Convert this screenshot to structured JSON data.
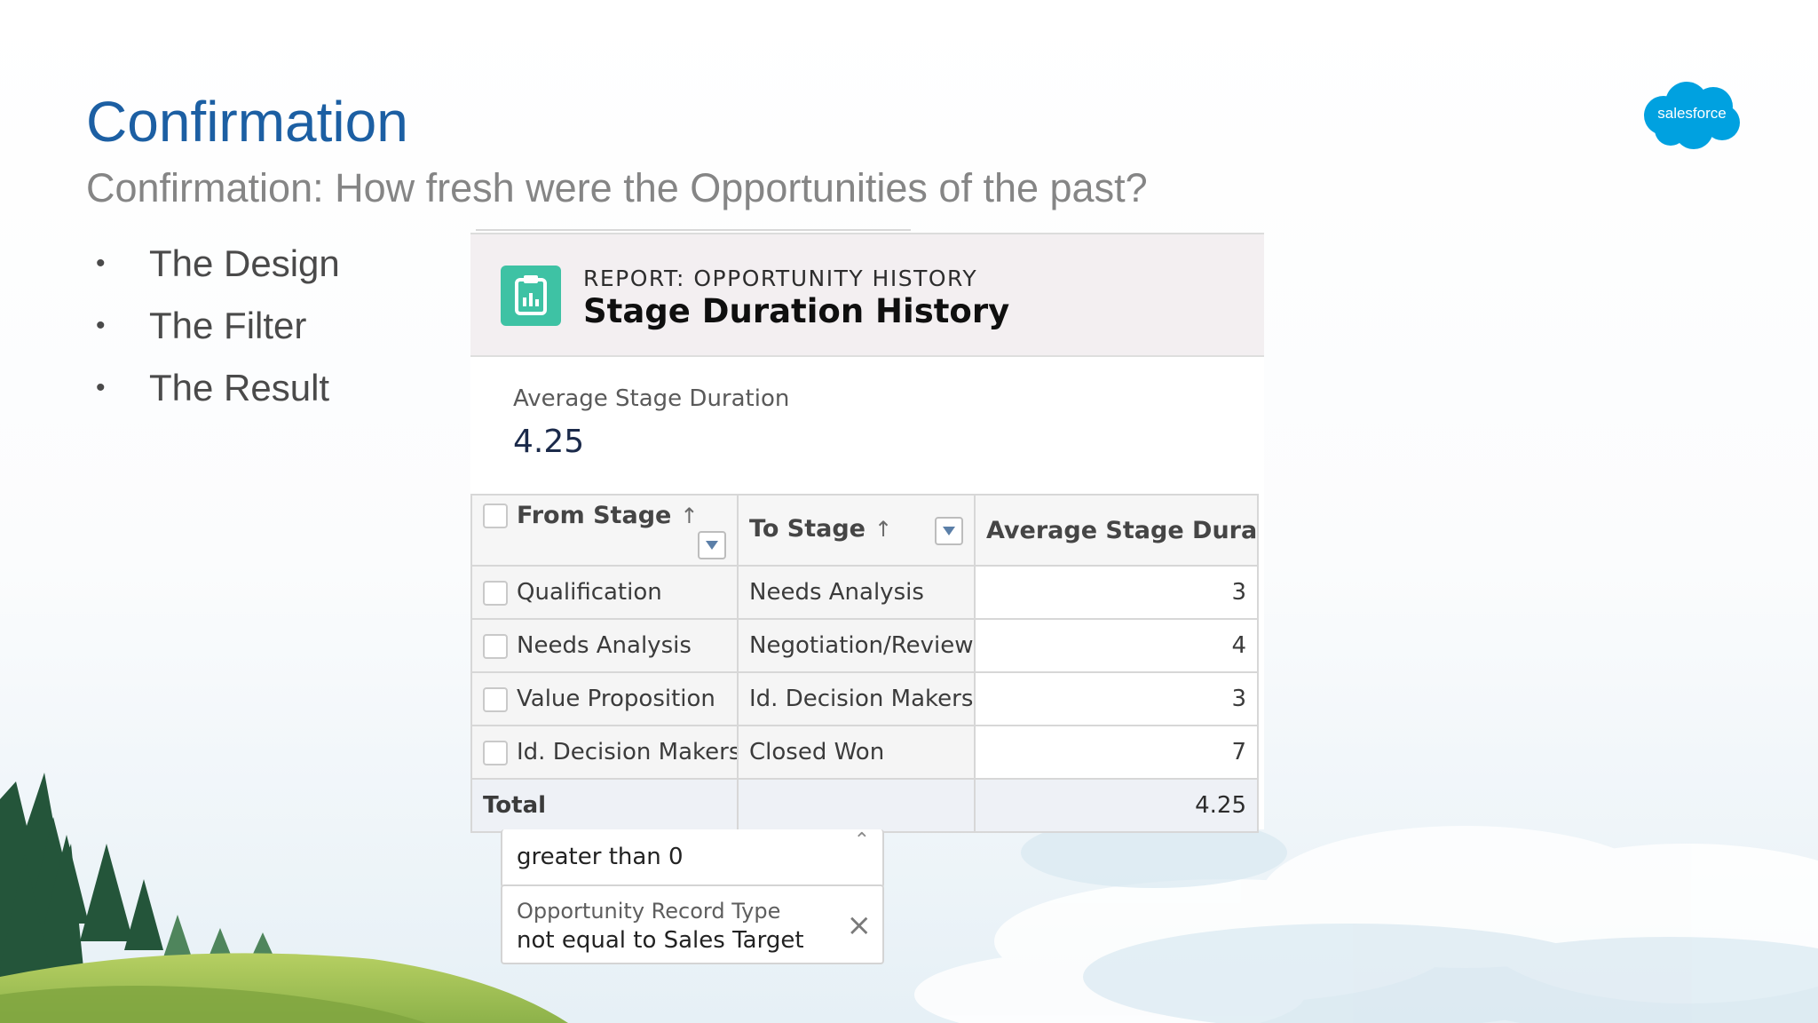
{
  "slide": {
    "title": "Confirmation",
    "subtitle": "Confirmation: How fresh were the Opportunities of the past?",
    "bullets": [
      "The Design",
      "The Filter",
      "The Result"
    ],
    "logo_text": "salesforce"
  },
  "report": {
    "kicker": "REPORT: OPPORTUNITY HISTORY",
    "title": "Stage Duration History",
    "metric_label": "Average Stage Duration",
    "metric_value": "4.25",
    "columns": [
      "From Stage",
      "To Stage",
      "Average Stage Duration"
    ],
    "rows": [
      {
        "from": "Qualification",
        "to": "Needs Analysis",
        "avg": "3"
      },
      {
        "from": "Needs Analysis",
        "to": "Negotiation/Review",
        "avg": "4"
      },
      {
        "from": "Value Proposition",
        "to": "Id. Decision Makers",
        "avg": "3"
      },
      {
        "from": "Id. Decision Makers",
        "to": "Closed Won",
        "avg": "7"
      }
    ],
    "total_label": "Total",
    "total_value": "4.25"
  },
  "filters": [
    {
      "value": "greater than 0"
    },
    {
      "label": "Opportunity Record Type",
      "value": "not equal to Sales Target"
    }
  ],
  "colors": {
    "title_blue": "#1c5fa3",
    "report_icon": "#3ec2a4",
    "salesforce_blue": "#00a1e0"
  }
}
